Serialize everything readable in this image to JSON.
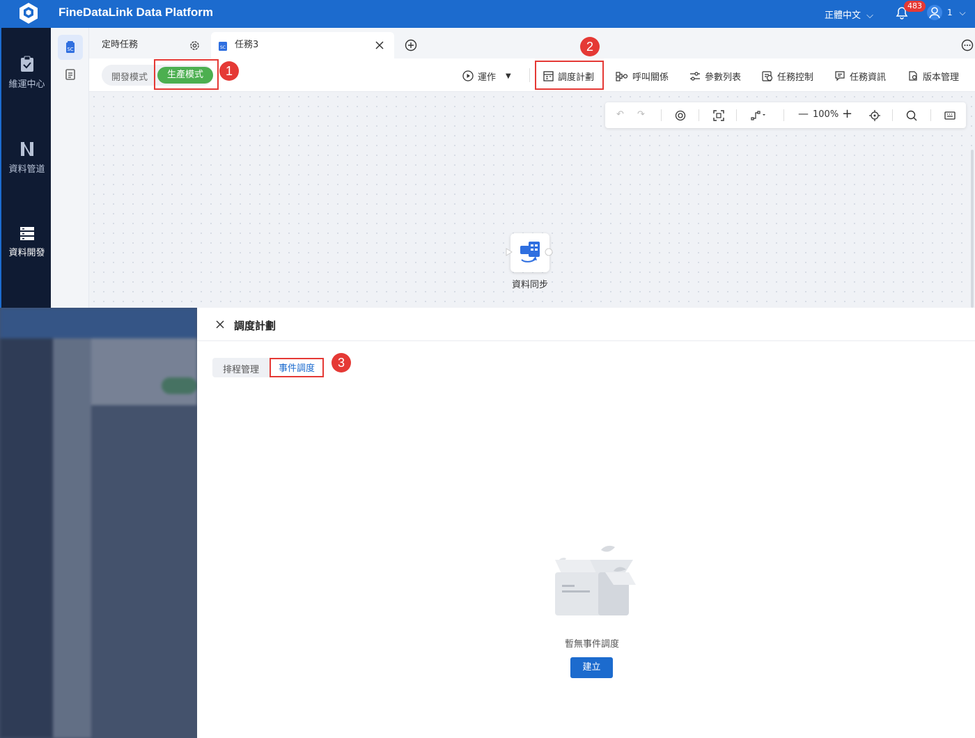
{
  "header": {
    "brand": "FineDataLink Data Platform",
    "language": "正體中文",
    "notification_count": "483",
    "user": "1"
  },
  "sidebar": {
    "items": [
      {
        "label": "維運中心",
        "icon": "clipboard-check-icon"
      },
      {
        "label": "資料管道",
        "icon": "pipeline-icon"
      },
      {
        "label": "資料開發",
        "icon": "database-dev-icon",
        "active": true
      }
    ]
  },
  "tabs": [
    {
      "label": "定時任務"
    },
    {
      "label": "任務3",
      "active": true
    }
  ],
  "mode": {
    "dev": "開發模式",
    "prod": "生產模式",
    "selected": "prod"
  },
  "toolbar": {
    "run": "運作",
    "schedule": "調度計劃",
    "call_relation": "呼叫關係",
    "param_list": "參數列表",
    "task_control": "任務控制",
    "task_info": "任務資訊",
    "version_manage": "版本管理"
  },
  "canvas": {
    "zoom": "100%",
    "node_label": "資料同步"
  },
  "markers": [
    "1",
    "2",
    "3"
  ],
  "panel": {
    "title": "調度計劃",
    "tabs": [
      "排程管理",
      "事件調度"
    ],
    "active_tab": "事件調度",
    "empty_text": "暫無事件調度",
    "create_label": "建立"
  },
  "colors": {
    "primary": "#1c6bce",
    "sidebar_bg": "#0f1b33",
    "prod_green": "#4caf50",
    "marker_red": "#e53935"
  }
}
